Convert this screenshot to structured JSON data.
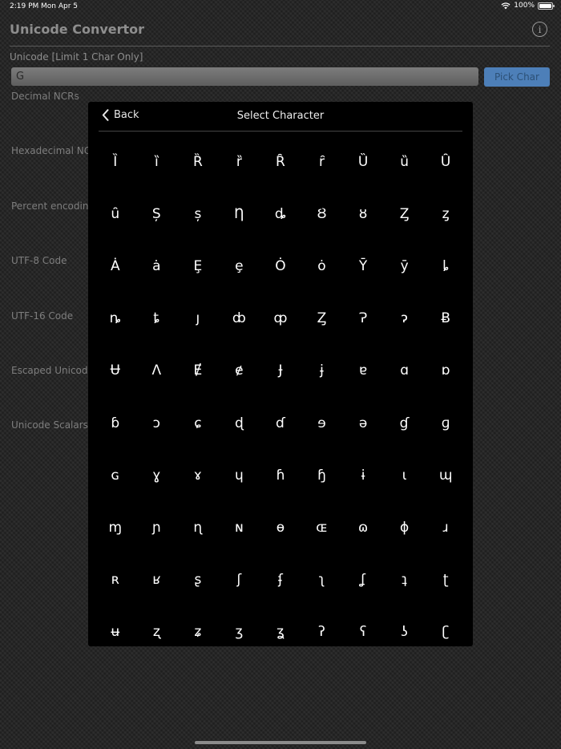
{
  "status_bar": {
    "time": "2:19 PM",
    "date": "Mon Apr 5",
    "battery": "100%"
  },
  "app": {
    "title": "Unicode Convertor",
    "info_icon": "info-icon"
  },
  "input": {
    "label": "Unicode [Limit 1 Char Only]",
    "value": "Ġ",
    "pick_button": "Pick Char"
  },
  "fields": [
    "Decimal NCRs",
    "Hexadecimal NCR",
    "Percent encoding",
    "UTF-8 Code",
    "UTF-16 Code",
    "Escaped Unicode",
    "Unicode Scalars"
  ],
  "picker": {
    "back_label": "Back",
    "title": "Select Character",
    "characters": [
      "Ȉ",
      "ȉ",
      "Ȑ",
      "ȑ",
      "Ȓ",
      "ȓ",
      "Ȕ",
      "ȕ",
      "Ȗ",
      "ȗ",
      "Ș",
      "ș",
      "Ƞ",
      "ȡ",
      "Ȣ",
      "ȣ",
      "Ȥ",
      "ȥ",
      "Ȧ",
      "ȧ",
      "Ȩ",
      "ȩ",
      "Ȯ",
      "ȯ",
      "Ȳ",
      "ȳ",
      "ȴ",
      "ȵ",
      "ȶ",
      "ȷ",
      "ȸ",
      "ȹ",
      "Ȥ",
      "Ɂ",
      "ɂ",
      "Ƀ",
      "Ʉ",
      "Ʌ",
      "Ɇ",
      "ɇ",
      "Ɉ",
      "ɉ",
      "ɐ",
      "ɑ",
      "ɒ",
      "ɓ",
      "ɔ",
      "ɕ",
      "ɖ",
      "ɗ",
      "ɘ",
      "ə",
      "ɠ",
      "ɡ",
      "ɢ",
      "ɣ",
      "ɤ",
      "ɥ",
      "ɦ",
      "ɧ",
      "ɨ",
      "ɩ",
      "ɰ",
      "ɱ",
      "ɲ",
      "ɳ",
      "ɴ",
      "ɵ",
      "ɶ",
      "ɷ",
      "ɸ",
      "ɹ",
      "ʀ",
      "ʁ",
      "ʂ",
      "ʃ",
      "ʄ",
      "ʅ",
      "ʆ",
      "ʇ",
      "ʈ",
      "ʉ",
      "ʐ",
      "ʑ",
      "ʒ",
      "ʓ",
      "ʔ",
      "ʕ",
      "ʖ",
      "ʗ"
    ]
  }
}
